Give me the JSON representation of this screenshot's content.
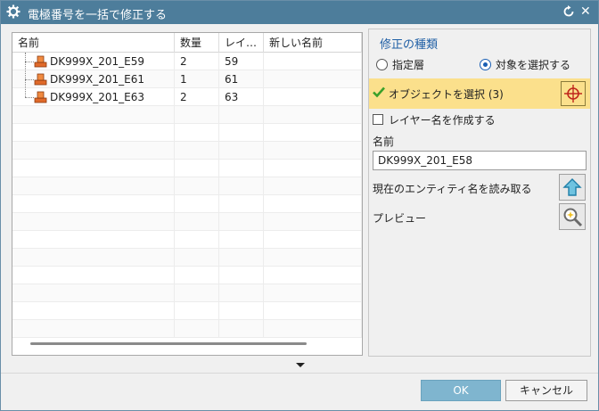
{
  "window": {
    "title": "電極番号を一括で修正する",
    "close_glyph": "✕"
  },
  "table": {
    "columns": [
      "名前",
      "数量",
      "レイ…",
      "新しい名前"
    ],
    "rows": [
      {
        "name": "DK999X_201_E59",
        "count": "2",
        "layer": "59",
        "new_name": ""
      },
      {
        "name": "DK999X_201_E61",
        "count": "1",
        "layer": "61",
        "new_name": ""
      },
      {
        "name": "DK999X_201_E63",
        "count": "2",
        "layer": "63",
        "new_name": ""
      }
    ]
  },
  "panel": {
    "group_title": "修正の種類",
    "radio_specified_layer": "指定層",
    "radio_select_object": "対象を選択する",
    "select_object_label": "オブジェクトを選択 (3)",
    "create_layer_name_label": "レイヤー名を作成する",
    "name_label": "名前",
    "name_value": "DK999X_201_E58",
    "read_entity_name_label": "現在のエンティティ名を読み取る",
    "preview_label": "プレビュー"
  },
  "buttons": {
    "ok": "OK",
    "cancel": "キャンセル"
  },
  "colors": {
    "titlebar": "#4d7d9b",
    "accent": "#1f5fa5",
    "selection_bar": "#fbe08c",
    "ok_button": "#7fb5cf"
  }
}
